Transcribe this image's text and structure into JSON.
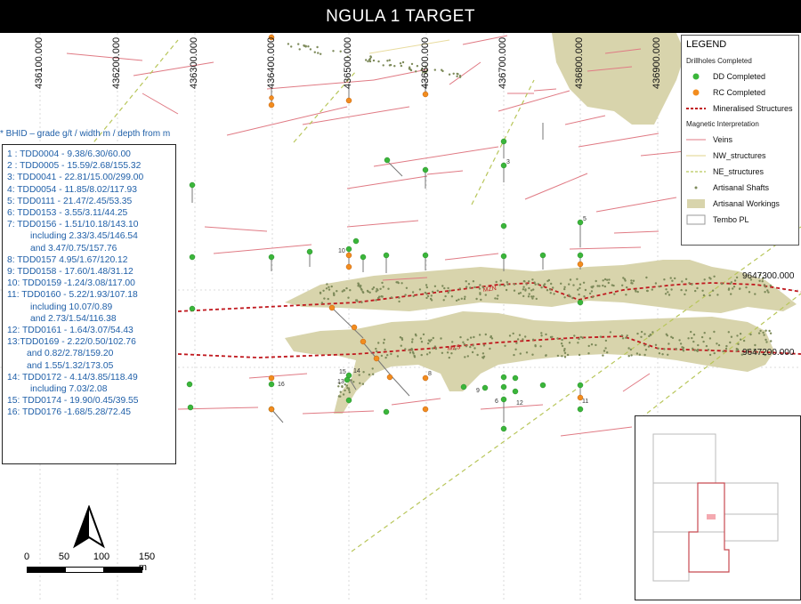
{
  "title": "NGULA 1 TARGET",
  "eastings": [
    "436100.000",
    "436200.000",
    "436300.000",
    "436400.000",
    "436500.000",
    "436600.000",
    "436700.000",
    "436800.000",
    "436900.000"
  ],
  "northings": [
    "9647300.000",
    "9647200.000"
  ],
  "structure_labels": {
    "mzn": "MZN",
    "mzs": "MZS"
  },
  "hole_labels": [
    "3",
    "5",
    "10",
    "15",
    "14",
    "13",
    "16",
    "8",
    "9",
    "6",
    "12",
    "11"
  ],
  "hint": "* BHID – grade g/t / width m / depth from m",
  "results": [
    "1 : TDD0004 - 9.38/6.30/60.00",
    "2 : TDD0005 - 15.59/2.68/155.32",
    "3: TDD0041 - 22.81/15.00/299.00",
    "4: TDD0054 - 11.85/8.02/117.93",
    "5: TDD0111 - 21.47/2.45/53.35",
    "6: TDD0153 - 3.55/3.11/44.25",
    "7: TDD0156 - 1.51/10.18/143.10",
    "including 2.33/3.45/146.54",
    "and 3.47/0.75/157.76",
    "8: TDD0157  4.95/1.67/120.12",
    "9: TDD0158 - 17.60/1.48/31.12",
    "10: TDD0159 -1.24/3.08/117.00",
    "11: TDD0160 - 5.22/1.93/107.18",
    "including 10.07/0.89",
    "and 2.73/1.54/116.38",
    "12: TDD0161 - 1.64/3.07/54.43",
    "13:TDD0169 - 2.22/0.50/102.76",
    "and 0.82/2.78/159.20",
    "and 1.55/1.32/173.05",
    "14: TDD0172 - 4.14/3.85/118.49",
    "including 7.03/2.08",
    "15: TDD0174 - 19.90/0.45/39.55",
    "16: TDD0176 -1.68/5.28/72.45"
  ],
  "legend": {
    "title": "LEGEND",
    "drillholes_heading": "Drillholes Completed",
    "dd": "DD Completed",
    "rc": "RC Completed",
    "mineralised": "Mineralised Structures",
    "magnetic_heading": "Magnetic Interpretation",
    "veins": "Veins",
    "nw": "NW_structures",
    "ne": "NE_structures",
    "shafts": "Artisanal Shafts",
    "workings": "Artisanal Workings",
    "tembo": "Tembo PL"
  },
  "scale": {
    "labels": [
      "0",
      "50",
      "100",
      "150 m"
    ]
  },
  "colors": {
    "dd": "#3ab63a",
    "rc": "#f28c1e",
    "mineralised": "#c0181e",
    "veins": "#e07a84",
    "nw": "#e8dca0",
    "ne": "#b8c65a",
    "shafts": "#7d8a5a",
    "workings": "#d8d4ac",
    "tembo_inset": "#c74a52"
  }
}
